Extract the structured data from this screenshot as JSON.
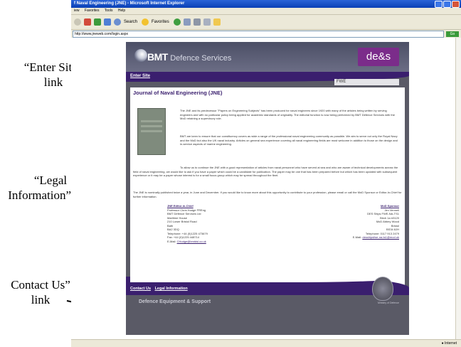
{
  "annotations": {
    "enter_site": "“Enter Site” link",
    "legal": "“Legal Information” link",
    "contact": "Contact Us” link"
  },
  "browser": {
    "title": "f Naval Engineering (JNE) - Microsoft Internet Explorer",
    "menu": [
      "iew",
      "Favorites",
      "Tools",
      "Help"
    ],
    "toolbar": {
      "search": "Search",
      "favorites": "Favorites"
    },
    "address": "http://www.jneweb.com/login.aspx",
    "go": "Go",
    "status_zone": "Internet"
  },
  "site": {
    "logo": "BMT",
    "logo_sub": "Defence Services",
    "brand_box": "de&s",
    "enter_site": "Enter Site",
    "fwe": "FWE",
    "jne_title": "Journal of Naval Engineering (JNE)",
    "para1": "The JNE and its predecessor \"Papers on Engineering Subjects\" has been produced for naval engineers since 1920 with many of the articles being written by serving engineers and with no particular policy being applied for academic standards of originality. The editorial function is now being performed by BMT Defence Services with the MoD retaining a supervisory role.",
    "para2": "BMT are keen to ensure that our constituency covers as wide a range of the professional naval engineering community as possible. We aim to serve not only the Royal Navy and the MoD but also the UK naval industry. Articles on general sea experience covering all naval engineering fields are most welcome in addition to those on the design and in-service aspects of marine engineering.",
    "para3": "To allow us to continue the JNE with a good representation of articles from naval personnel who have served at sea and who are aware of technical developments across the field of naval engineering, we would like to ask if you have a paper which could be a candidate for publication. The paper may be one that has been prepared before but which has been updated with subsequent experience or it may be a paper whose interest is for a small focus group which may be spread throughout the fleet.",
    "para4": "The JNE is nominally published twice a year, in June and December. If you would like to know more about this opportunity to contribute to your profession, please email or call the MoD Sponsor or Editor-In-Chief for further information.",
    "editor": {
      "heading": "JNE Editor-in-Chief",
      "lines": [
        "Professor Chris Hodge FREng",
        "BMT Defence Services Ltd",
        "Maritime House",
        "210 Lower Bristol Road",
        "Bath",
        "BA2 3DQ",
        "Telephone: +44 (0)1225 473679",
        "Fax: +44 (0)1225 448714"
      ],
      "email_label": "E-Mail:",
      "email": "CHodge@bmtdsl.co.uk"
    },
    "sponsor": {
      "heading": "MoD Sponsor",
      "lines": [
        "Jim Vennell",
        "DES Ships FWE-NA-TS1",
        "Birch 1a #3120",
        "MoD Abbey Wood",
        "Bristol",
        "BS34 8JH",
        "Telephone: 0117 913 2479"
      ],
      "email_label": "E-Mail:",
      "email": "desshipsfwe-na-ts1@mod.uk"
    },
    "footer_contact": "Contact Us",
    "footer_legal": "Legal Information",
    "footer_brand": "Defence Equipment & Support",
    "crest_caption": "Ministry of Defence"
  }
}
